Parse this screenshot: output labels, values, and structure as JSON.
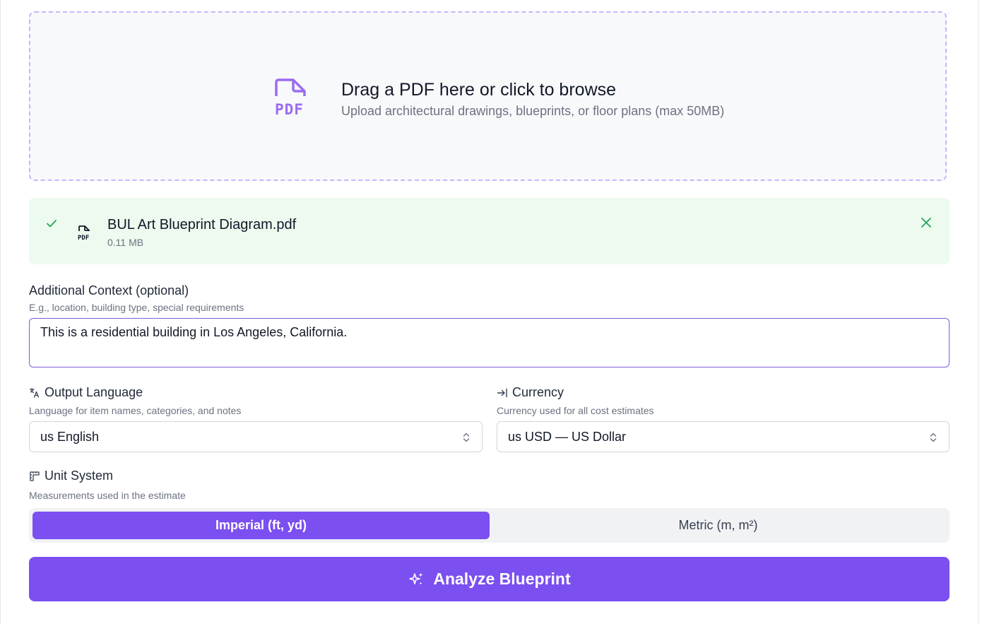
{
  "dropzone": {
    "title": "Drag a PDF here or click to browse",
    "subtitle": "Upload architectural drawings, blueprints, or floor plans (max 50MB)",
    "icon": "pdf-file-icon"
  },
  "uploaded_file": {
    "name": "BUL Art Blueprint Diagram.pdf",
    "size": "0.11 MB",
    "status_icon": "check-icon",
    "remove_icon": "close-icon"
  },
  "context": {
    "label": "Additional Context (optional)",
    "hint": "E.g., location, building type, special requirements",
    "value": "This is a residential building in Los Angeles, California."
  },
  "output_language": {
    "icon": "translate-icon",
    "label": "Output Language",
    "hint": "Language for item names, categories, and notes",
    "selected": "us English"
  },
  "currency": {
    "icon": "arrow-right-to-line-icon",
    "label": "Currency",
    "hint": "Currency used for all cost estimates",
    "selected": "us USD — US Dollar"
  },
  "unit_system": {
    "icon": "ruler-icon",
    "label": "Unit System",
    "hint": "Measurements used in the estimate",
    "options": [
      "Imperial (ft, yd)",
      "Metric (m, m²)"
    ],
    "selected_index": 0
  },
  "analyze_button": {
    "label": "Analyze Blueprint",
    "icon": "sparkles-icon"
  },
  "colors": {
    "accent": "#7b4ff0",
    "success_bg": "#ecfaef",
    "success_icon": "#22a55b",
    "dropzone_border": "#c4b5fd"
  }
}
